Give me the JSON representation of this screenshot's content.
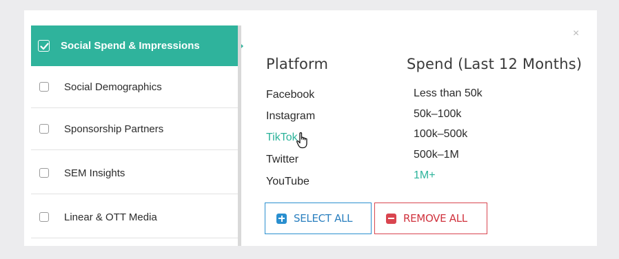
{
  "sidebar": {
    "items": [
      {
        "label": "Social Spend & Impressions",
        "checked": true
      },
      {
        "label": "Social Demographics",
        "checked": false
      },
      {
        "label": "Sponsorship Partners",
        "checked": false
      },
      {
        "label": "SEM Insights",
        "checked": false
      },
      {
        "label": "Linear & OTT Media",
        "checked": false
      }
    ]
  },
  "close_label": "×",
  "filters": {
    "platform": {
      "header": "Platform",
      "options": [
        "Facebook",
        "Instagram",
        "TikTok",
        "Twitter",
        "YouTube"
      ],
      "highlighted": "TikTok"
    },
    "spend": {
      "header": "Spend (Last 12 Months)",
      "options": [
        "Less than 50k",
        "50k–100k",
        "100k–500k",
        "500k–1M",
        "1M+"
      ],
      "highlighted": "1M+"
    }
  },
  "buttons": {
    "select_all": "SELECT ALL",
    "remove_all": "REMOVE ALL"
  },
  "colors": {
    "accent": "#2fb39c",
    "select": "#2a8fcf",
    "remove": "#d9454f"
  },
  "icons": {
    "select_all": "plus-square-icon",
    "remove_all": "minus-square-icon",
    "cursor": "hand-pointer-icon",
    "checked": "checkmark-icon"
  }
}
